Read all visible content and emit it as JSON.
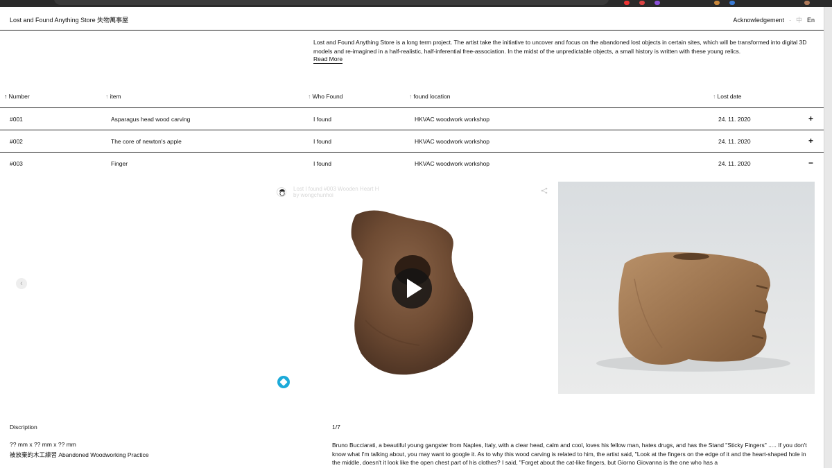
{
  "header": {
    "site_title": "Lost and Found Anything Store 失物萬事屋",
    "nav_acknowledgement": "Acknowledgement",
    "nav_separator": "·",
    "lang_zh": "中",
    "lang_en": "En"
  },
  "intro": {
    "text": "Lost and Found Anything Store is a long term project. The artist take the initiative to uncover and focus on the abandoned lost objects in certain sites, which will be transformed into digital 3D models and re-imagined in a half-realistic, half-inferential free-association. In the midst of the unpredictable objects, a small history is written with these young relics.",
    "read_more": "Read More"
  },
  "table": {
    "columns": [
      "Number",
      "item",
      "Who Found",
      "found location",
      "Lost date"
    ],
    "sort_arrow": "↑",
    "rows": [
      {
        "number": "#001",
        "item": "Asparagus head wood carving",
        "who": "I found",
        "location": "HKVAC woodwork workshop",
        "date": "24. 11. 2020",
        "toggle": "+"
      },
      {
        "number": "#002",
        "item": "The core of newton's apple",
        "who": "I found",
        "location": "HKVAC woodwork workshop",
        "date": "24. 11. 2020",
        "toggle": "+"
      },
      {
        "number": "#003",
        "item": "Finger",
        "who": "I found",
        "location": "HKVAC woodwork workshop",
        "date": "24. 11. 2020",
        "toggle": "−"
      }
    ]
  },
  "gallery": {
    "prev_icon": "‹",
    "next_icon": "›",
    "viewer_title": "Lost I found #003 Wooden Heart H",
    "viewer_by": "by wongchunhoi",
    "share_icon": "share-icon",
    "play_icon": "play-icon",
    "brand_icon": "sketchfab-logo-icon"
  },
  "detail": {
    "label": "Discription",
    "dimensions": "?? mm x ?? mm x ?? mm",
    "project": "被放棄的木工練習 Abandoned Woodworking Practice",
    "counter": "1/7",
    "story": "Bruno Bucciarati, a beautiful young gangster from Naples, Italy, with a clear head, calm and cool, loves his fellow man, hates drugs, and has the Stand \"Sticky Fingers\" ..... If you don't know what I'm talking about, you may want to google it. As to why this wood carving is related to him, the artist said, \"Look at the fingers on the edge of it and the heart-shaped hole in the middle, doesn't it look like the open chest part of his clothes? I said, \"Forget about the cat-like fingers, but Giorno Giovanna is the one who has a"
  },
  "colors": {
    "rule": "#222222",
    "sketchfab": "#1caad9",
    "wood": "#6e4b33"
  }
}
